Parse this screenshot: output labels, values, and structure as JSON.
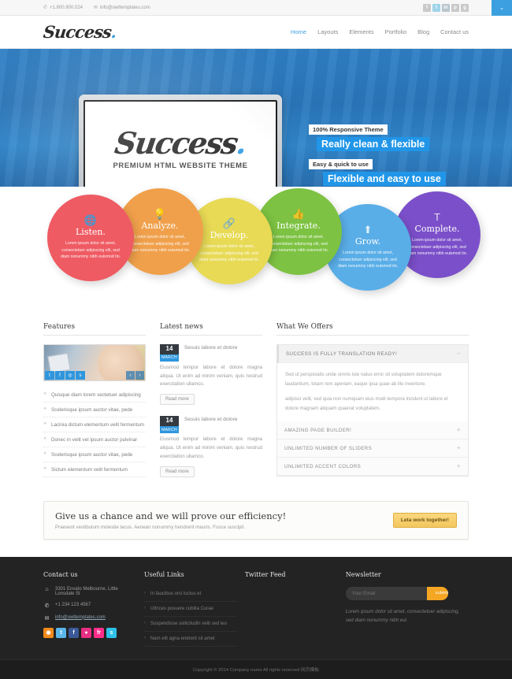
{
  "topbar": {
    "phone": "+1.800.900.024",
    "email": "info@owltemplates.com",
    "phone_icon": "phone-icon",
    "email_icon": "envelope-icon",
    "social": [
      {
        "name": "facebook",
        "glyph": "f"
      },
      {
        "name": "twitter",
        "glyph": "t"
      },
      {
        "name": "linkedin",
        "glyph": "in"
      },
      {
        "name": "pinterest",
        "glyph": "p"
      },
      {
        "name": "google-plus",
        "glyph": "g"
      }
    ],
    "toggle_glyph": "⌄"
  },
  "header": {
    "logo": "Success",
    "logo_dot": ".",
    "nav": [
      {
        "label": "Home",
        "active": true
      },
      {
        "label": "Layouts",
        "active": false
      },
      {
        "label": "Elements",
        "active": false
      },
      {
        "label": "Portfolio",
        "active": false
      },
      {
        "label": "Blog",
        "active": false
      },
      {
        "label": "Contact us",
        "active": false
      }
    ]
  },
  "hero": {
    "screen_logo": "Success",
    "screen_logo_dot": ".",
    "screen_subtitle": "PREMIUM HTML WEBSITE THEME",
    "banner1_small": "100% Responsive Theme",
    "banner1_large": "Really clean & flexible",
    "banner2_small": "Easy & quick to use",
    "banner2_large": "Flexible and easy to use",
    "accent": "#2196e8"
  },
  "circles": [
    {
      "title": "Listen.",
      "icon": "globe-icon",
      "glyph": "⊕",
      "text": "Lorem ipsum dolor sit amet, consectetuer adipiscing elit, sed diam nonummy nibh euismod tin.",
      "color": "#ef5b63"
    },
    {
      "title": "Analyze.",
      "icon": "lightbulb-icon",
      "glyph": "Ὂ1",
      "text": "Lorem ipsum dolor sit amet, consectetuer adipiscing elit, sed diam nonummy nibh euismod tin.",
      "color": "#f0a04b"
    },
    {
      "title": "Develop.",
      "icon": "link-icon",
      "glyph": "⚭",
      "text": "Lorem ipsum dolor sit amet, consectetuer adipiscing elit, sed diam nonummy nibh euismod tin.",
      "color": "#e8da55"
    },
    {
      "title": "Integrate.",
      "icon": "thumbs-up-icon",
      "glyph": "☝",
      "text": "Lorem ipsum dolor sit amet, consectetuer adipiscing elit, sed diam nonummy nibh euismod tin.",
      "color": "#7dc242"
    },
    {
      "title": "Grow.",
      "icon": "upload-icon",
      "glyph": "⇧",
      "text": "Lorem ipsum dolor sit amet, consectetuer adipiscing elit, sed diam nonummy nibh euismod tin.",
      "color": "#5aaee8"
    },
    {
      "title": "Complete.",
      "icon": "text-tool-icon",
      "glyph": "T",
      "text": "Lorem ipsum dolor sit amet, consectetuer adipiscing elit, sed diam nonummy nibh euismod tin.",
      "color": "#7b4fc9"
    }
  ],
  "features": {
    "title": "Features",
    "image_social": [
      {
        "name": "twitter",
        "glyph": "t"
      },
      {
        "name": "facebook",
        "glyph": "f"
      },
      {
        "name": "globe",
        "glyph": "◎"
      },
      {
        "name": "skype",
        "glyph": "s"
      }
    ],
    "prev_glyph": "‹",
    "next_glyph": "›",
    "items": [
      "Quisque diam lorem sectetuer adipiscing",
      "Scelerisque ipsum auctor vitae, pede",
      "Lacinia dictum elementum velit fermentum",
      "Donec in velit vel ipsum auctor pulvinar",
      "Scelerisque ipsum auctor vitae, pede",
      "Sictum elementum velit fermentum"
    ]
  },
  "news": {
    "title": "Latest news",
    "items": [
      {
        "day": "14",
        "month": "MARCH",
        "title": "Sesuis labore et dolore",
        "text": "Eiusmod tempor labore et dolore magna aliqua. Ut enim ad minim veniam, quis nostrud exercitation ullamco.",
        "button": "Read more"
      },
      {
        "day": "14",
        "month": "MARCH",
        "title": "Sesuis labore et dolore",
        "text": "Eiusmod tempor labore et dolore magna aliqua. Ut enim ad minim veniam, quis nostrud exercitation ullamco.",
        "button": "Read more"
      }
    ]
  },
  "offers": {
    "title": "What We Offers",
    "accordion": [
      {
        "label": "SUCCESS IS FULLY TRANSLATION READY!",
        "sign": "–",
        "open": true,
        "body": [
          "Sed ut perspiciatis unde omnis iste natus error sit voluptatem doloremque laudantium, totam rem aperiam, eaque ipsa quae ab illo inventore.",
          "adipisci velit, sed quia non numquam eius modi tempora incidunt ut labore et dolore magnam aliquam quaerat voluptatem."
        ]
      },
      {
        "label": "AMAZING PAGE BUILDER!",
        "sign": "+",
        "open": false,
        "body": []
      },
      {
        "label": "UNLIMITED NUMBER OF SLIDERS",
        "sign": "+",
        "open": false,
        "body": []
      },
      {
        "label": "UNLIMITED ACCENT COLORS",
        "sign": "+",
        "open": false,
        "body": []
      }
    ]
  },
  "cta": {
    "title": "Give us a chance and we will prove our efficiency!",
    "subtitle": "Praesent vestibulum molestie lacus. Aenean nonummy hendrerit mauris. Fusce suscipit.",
    "button": "Leta work together!"
  },
  "footer": {
    "contact": {
      "title": "Contact us",
      "address": "3301 Envato Melbourne, Little Lonsdale St",
      "address_icon": "home-icon",
      "phone": "+1 234 123 4567",
      "phone_icon": "phone-icon",
      "email": "info@owltemplates.com",
      "email_icon": "envelope-icon",
      "social": [
        {
          "name": "rss",
          "glyph": "◉",
          "cls": "rss"
        },
        {
          "name": "twitter",
          "glyph": "t",
          "cls": "tw"
        },
        {
          "name": "facebook",
          "glyph": "f",
          "cls": "fb"
        },
        {
          "name": "dribbble",
          "glyph": "●",
          "cls": "dr"
        },
        {
          "name": "flickr",
          "glyph": "fr",
          "cls": "fr"
        },
        {
          "name": "skype",
          "glyph": "s",
          "cls": "sk"
        }
      ]
    },
    "links": {
      "title": "Useful Links",
      "items": [
        "In faucibus orci luctus et",
        "Ultrices posuere cubilia Curae",
        "Suspendisse sollicitudin velit sed leo",
        "Nam elit agna endrerit sit amet"
      ]
    },
    "twitter": {
      "title": "Twitter Feed"
    },
    "newsletter": {
      "title": "Newsletter",
      "placeholder": "Your Email",
      "value": "",
      "button": "submit",
      "text": "Lorem ipsum dolor sit amet, consectetuer adipiscing, sed diam nonummy nibh eui"
    },
    "copyright": "Copyright © 2014 Company name All rights reserved 网页模板"
  }
}
